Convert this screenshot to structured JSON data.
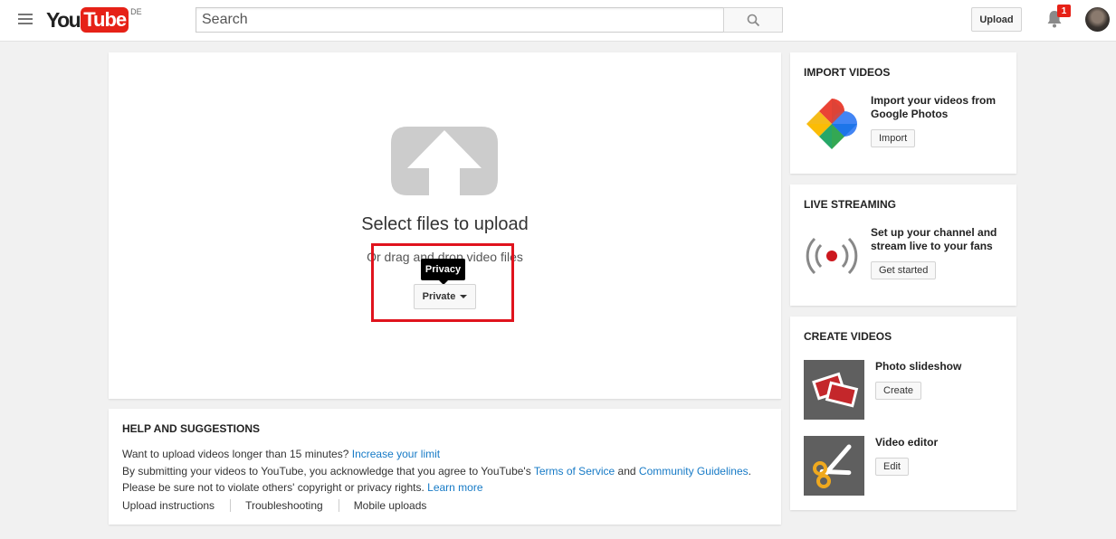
{
  "masthead": {
    "logo_you": "You",
    "logo_tube": "Tube",
    "logo_region": "DE",
    "search_placeholder": "Search",
    "upload_label": "Upload",
    "notification_count": "1"
  },
  "upload": {
    "title": "Select files to upload",
    "drag_text": "Or drag and drop video files",
    "privacy_tooltip": "Privacy",
    "privacy_value": "Private"
  },
  "help": {
    "title": "HELP AND SUGGESTIONS",
    "line1_text": "Want to upload videos longer than 15 minutes?",
    "line1_link": "Increase your limit",
    "line2_text": "By submitting your videos to YouTube, you acknowledge that you agree to YouTube's",
    "line2_link1": "Terms of Service",
    "line2_and": "and",
    "line2_link2": "Community Guidelines",
    "line2_end": ".",
    "line3_text": "Please be sure not to violate others' copyright or privacy rights.",
    "line3_link": "Learn more",
    "links": [
      "Upload instructions",
      "Troubleshooting",
      "Mobile uploads"
    ]
  },
  "import_videos": {
    "title": "IMPORT VIDEOS",
    "text": "Import your videos from Google Photos",
    "button": "Import"
  },
  "live_streaming": {
    "title": "LIVE STREAMING",
    "text": "Set up your channel and stream live to your fans",
    "button": "Get started"
  },
  "create_videos": {
    "title": "CREATE VIDEOS",
    "slideshow_title": "Photo slideshow",
    "slideshow_button": "Create",
    "editor_title": "Video editor",
    "editor_button": "Edit"
  },
  "colors": {
    "brand_red": "#e62117",
    "link_blue": "#167ac6",
    "highlight_red": "#e0131d"
  }
}
